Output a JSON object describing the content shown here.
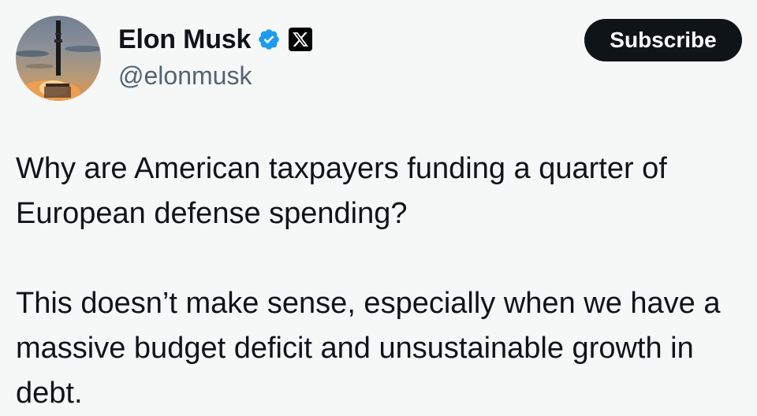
{
  "author": {
    "display_name": "Elon Musk",
    "handle": "@elonmusk",
    "verified": true,
    "affiliate_badge_icon": "x-logo-icon",
    "avatar_icon": "rocket-avatar"
  },
  "actions": {
    "subscribe_label": "Subscribe"
  },
  "tweet": {
    "paragraph_1": "Why are American taxpayers funding a quarter of European defense spending?",
    "paragraph_2": "This doesn’t make sense, especially when we have a massive budget deficit and unsustainable growth in debt."
  },
  "colors": {
    "background": "#f6f7f7",
    "text": "#0f1419",
    "secondary_text": "#536471",
    "verified_blue": "#1d9bf0",
    "button_bg": "#0f1419"
  }
}
